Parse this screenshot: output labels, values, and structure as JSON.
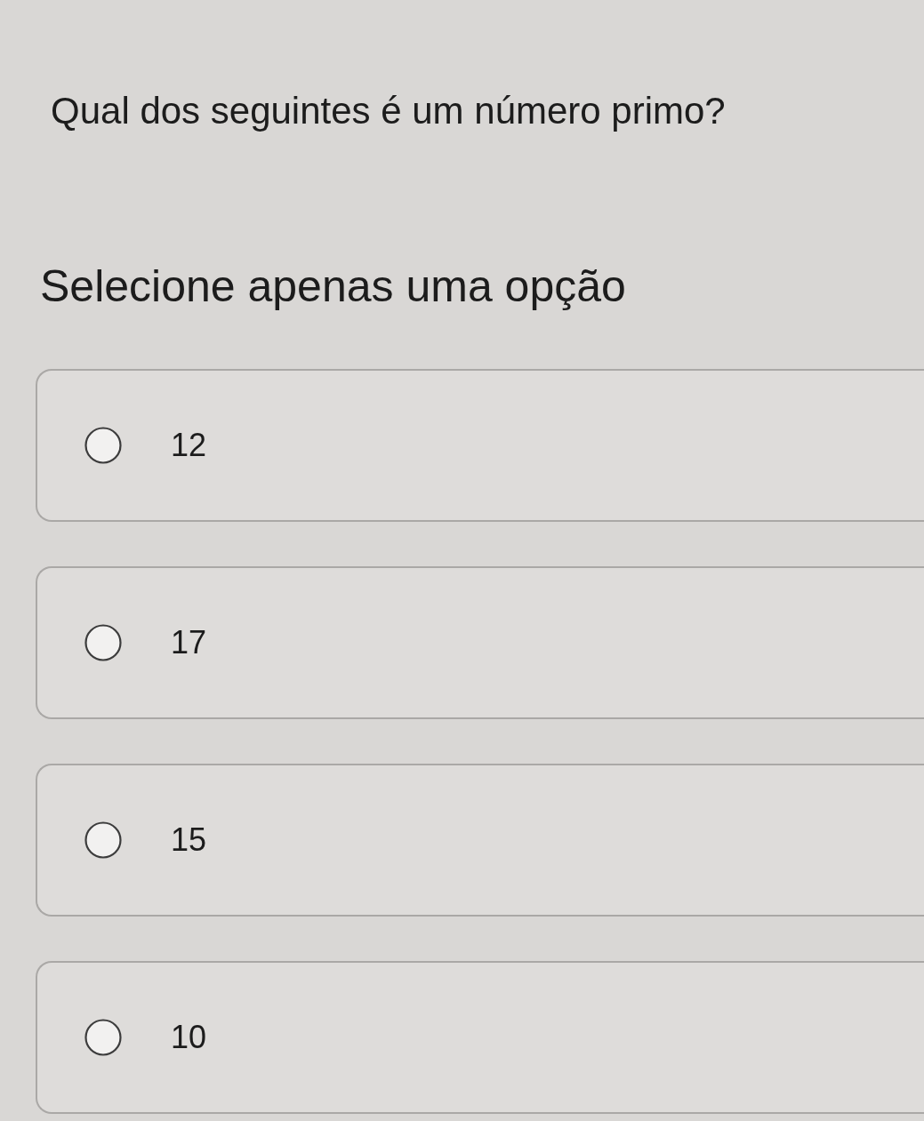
{
  "question": "Qual dos seguintes é um número primo?",
  "instruction": "Selecione apenas uma opção",
  "options": [
    {
      "label": "12",
      "selected": false
    },
    {
      "label": "17",
      "selected": false
    },
    {
      "label": "15",
      "selected": false
    },
    {
      "label": "10",
      "selected": false
    }
  ]
}
